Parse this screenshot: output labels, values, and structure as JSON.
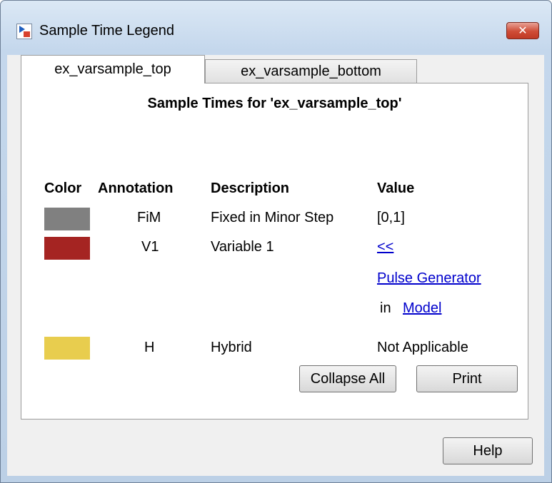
{
  "window": {
    "title": "Sample Time Legend",
    "close_label": "✕"
  },
  "tabs": [
    {
      "label": "ex_varsample_top",
      "active": true
    },
    {
      "label": "ex_varsample_bottom",
      "active": false
    }
  ],
  "panel": {
    "title": "Sample Times for 'ex_varsample_top'",
    "headers": {
      "color": "Color",
      "annotation": "Annotation",
      "description": "Description",
      "value": "Value"
    },
    "rows": [
      {
        "color": "#808080",
        "annotation": "FiM",
        "description": "Fixed in Minor Step",
        "value": "[0,1]"
      },
      {
        "color": "#a52422",
        "annotation": "V1",
        "description": "Variable 1",
        "value_link": "<<",
        "block_link": "Pulse Generator",
        "in_text": "in",
        "model_link": "Model"
      },
      {
        "color": "#e8cd4e",
        "annotation": "H",
        "description": "Hybrid",
        "value": "Not Applicable"
      }
    ],
    "collapse_all_label": "Collapse All",
    "print_label": "Print"
  },
  "help_label": "Help"
}
